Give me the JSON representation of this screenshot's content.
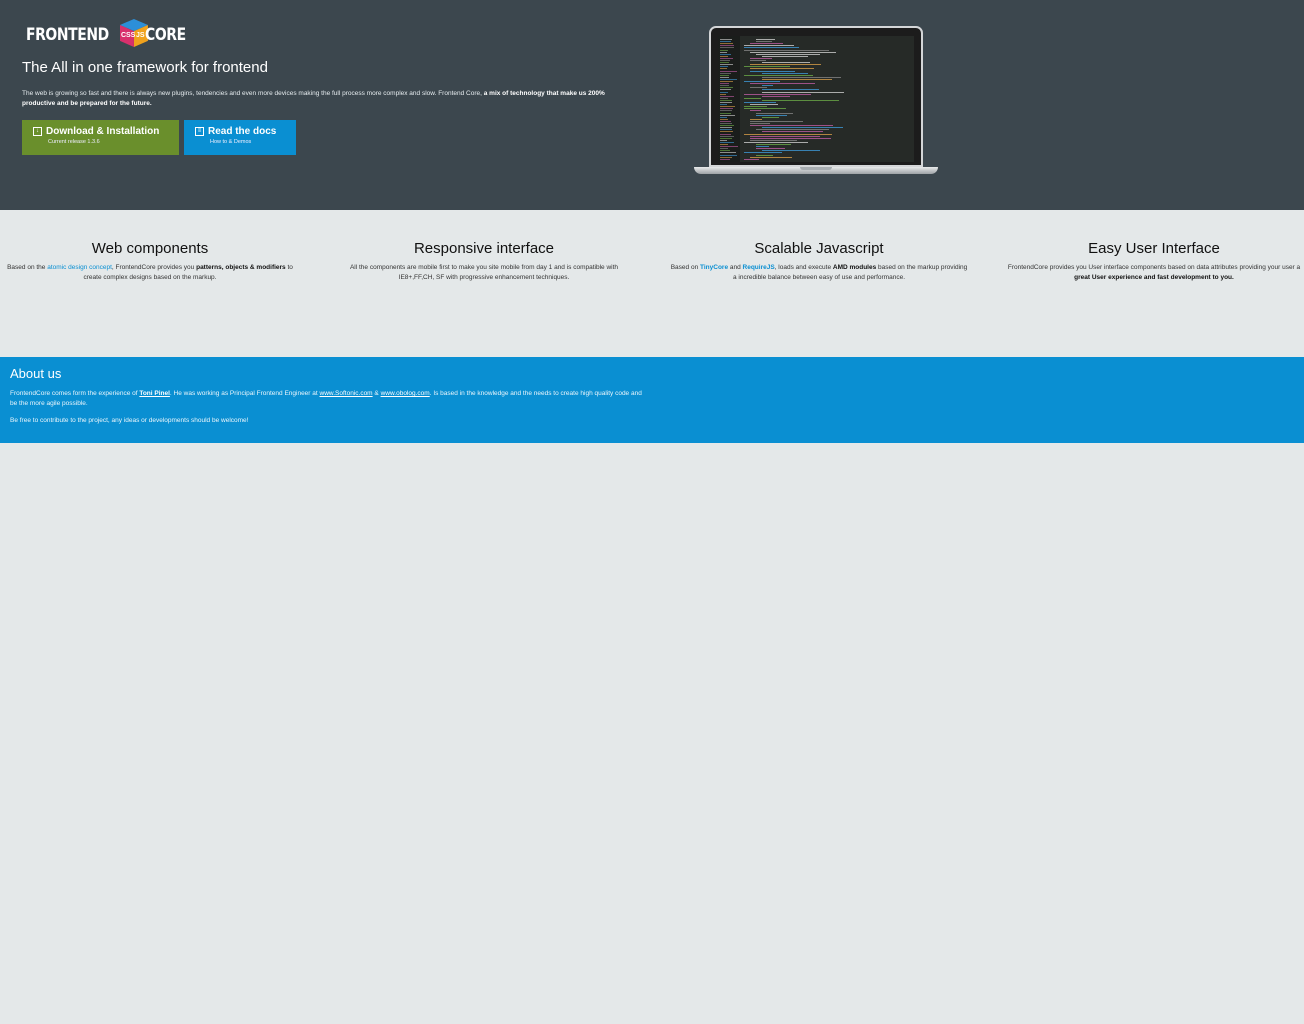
{
  "header": {
    "logo": {
      "left_text": "FRONTEND",
      "right_text": "CORE",
      "cube_left": "CSS",
      "cube_right": "JS"
    },
    "title": "The All in one framework for frontend",
    "description_plain": "The web is growing so fast and there is always new plugins, tendencies and even more devices making the full process more complex and slow. Frontend Core, ",
    "description_bold": "a mix of technology that make us 200% productive and be prepared for the future.",
    "buttons": {
      "download": {
        "label": "Download & Installation",
        "sub": "Current release 1.3.6"
      },
      "docs": {
        "label": "Read the docs",
        "sub": "How to & Demos"
      }
    }
  },
  "features": {
    "web": {
      "title": "Web components",
      "t1": "Based on the ",
      "link": "atomic design concept",
      "t2": ", FrontendCore provides you ",
      "bold": "patterns, objects & modifiers",
      "t3": " to create complex designs based on the markup."
    },
    "responsive": {
      "title": "Responsive interface",
      "text": "All the components are mobile first to make you site mobile from day 1 and is compatible with IE8+,FF,CH, SF with progressive enhancement techniques."
    },
    "scalable": {
      "title": "Scalable Javascript",
      "t1": "Based on ",
      "link1": "TinyCore",
      "t2": " and ",
      "link2": "RequireJS",
      "t3": ", loads and execute ",
      "bold": "AMD modules",
      "t4": " based on the markup providing a incredible balance between easy of use and performance."
    },
    "easy": {
      "title": "Easy User Interface",
      "t1": "FrontendCore provides you User interface components based on data attributes providing your user a ",
      "bold": "great User experience and fast development to you."
    }
  },
  "about": {
    "title": "About us",
    "p1_a": "FrontendCore comes form the experience of ",
    "person": "Toni Pinel",
    "p1_b": ". He was working as Principal Frontend Engineer at ",
    "link1": "www.Softonic.com",
    "p1_c": " & ",
    "link2": "www.obolog.com",
    "p1_d": ". Is based in the knowledge and the needs to create high quality code and be the more agile possible.",
    "p2": "Be free to contribute to the project, any ideas or developments should be welcome!"
  },
  "colors": {
    "hero_bg": "#3c474e",
    "download_btn": "#6a8f2c",
    "docs_btn": "#0a8fd2",
    "about_bg": "#0a8fd2",
    "page_bg": "#e4e8e9"
  },
  "icons": {
    "download": "download-icon",
    "docs": "book-icon"
  }
}
